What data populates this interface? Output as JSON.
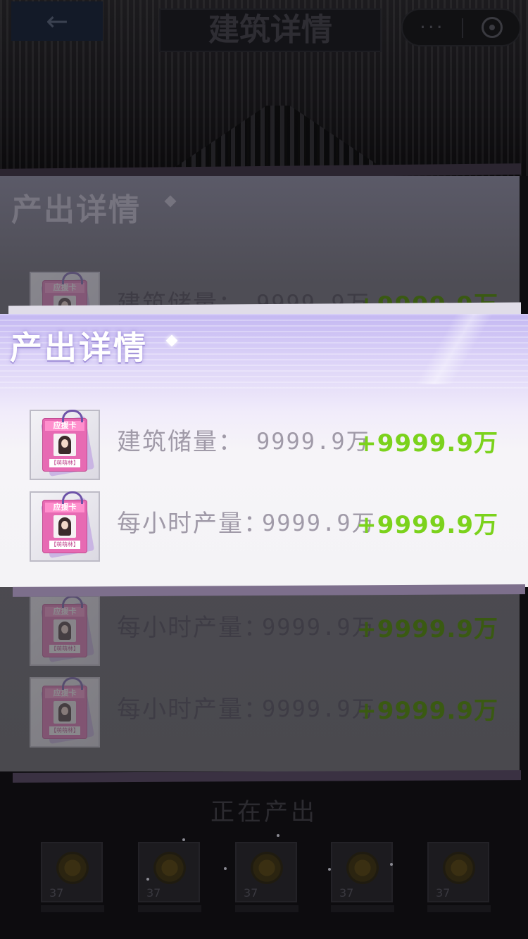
{
  "topbar": {
    "back_label": "←",
    "title": "建筑详情",
    "more_label": "···"
  },
  "popup": {
    "title": "产出详情",
    "card_header": "应援卡",
    "card_footer": "【萌萌林】",
    "rows": [
      {
        "label": "建筑储量：",
        "value": "9999.9万",
        "gain": "+9999.9万",
        "icon": "cheer-card-icon"
      },
      {
        "label": "每小时产量：",
        "value": "9999.9万",
        "gain": "+9999.9万",
        "icon": "cheer-card-icon"
      }
    ]
  },
  "background_panel": {
    "title": "产出详情",
    "rows": [
      {
        "label": "建筑储量：",
        "value": "9999.9万",
        "gain": "+9999.9万"
      },
      {
        "label": "每小时产量：",
        "value": "9999.9万",
        "gain": "+9999.9万"
      },
      {
        "label": "每小时产量：",
        "value": "9999.9万",
        "gain": "+9999.9万"
      }
    ]
  },
  "producing": {
    "title": "正在产出",
    "slots": [
      {
        "count": "37"
      },
      {
        "count": "37"
      },
      {
        "count": "37"
      },
      {
        "count": "37"
      },
      {
        "count": "37"
      }
    ]
  },
  "colors": {
    "gain_green": "#7bd21c",
    "label_gray": "#a09aa8",
    "popup_lavender": "#c4b8f2"
  }
}
